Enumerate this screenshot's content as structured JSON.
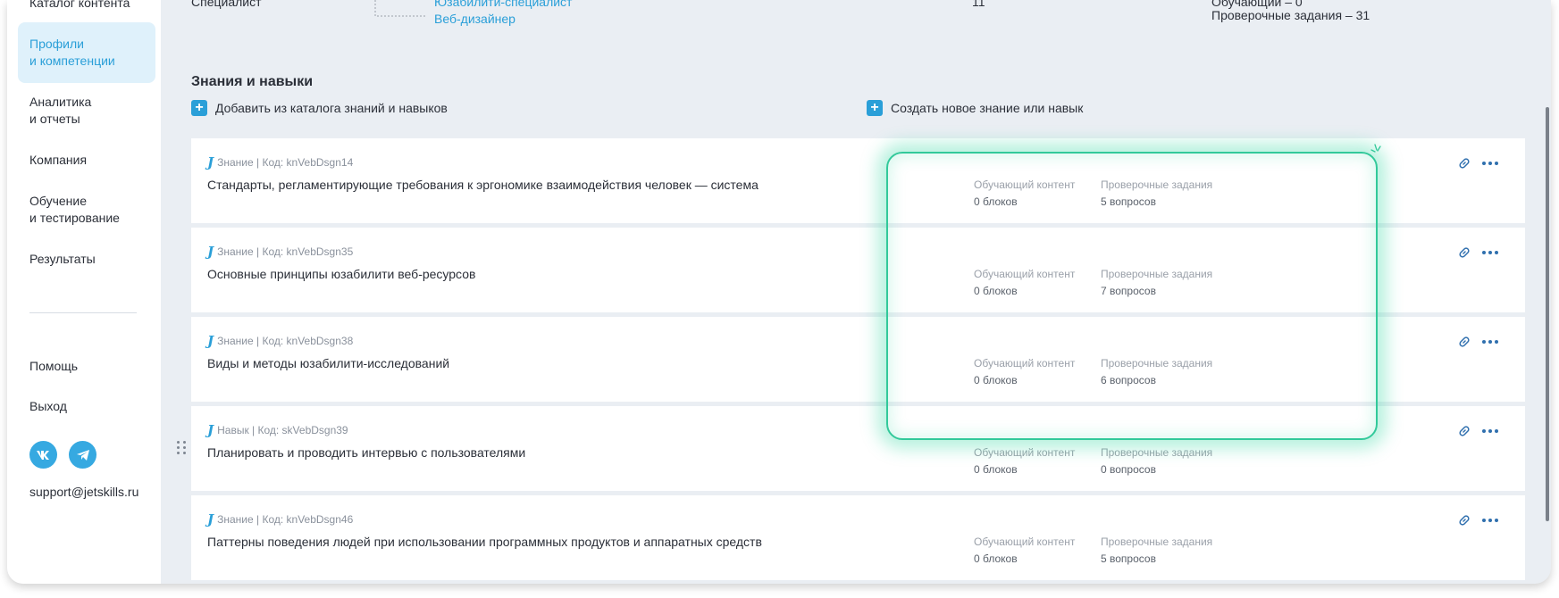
{
  "sidebar": {
    "items": [
      {
        "label": "Каталог контента"
      },
      {
        "label_line1": "Профили",
        "label_line2": "и компетенции"
      },
      {
        "label_line1": "Аналитика",
        "label_line2": "и отчеты"
      },
      {
        "label": "Компания"
      },
      {
        "label_line1": "Обучение",
        "label_line2": "и тестирование"
      },
      {
        "label": "Результаты"
      }
    ],
    "help": "Помощь",
    "logout": "Выход",
    "social": {
      "vk": "vk",
      "telegram": "telegram"
    },
    "support_email": "support@jetskills.ru"
  },
  "header_partial": {
    "left_text": "Специалист",
    "tree_item_top": "Юзабилити-специалист",
    "tree_item": "Веб-дизайнер",
    "count": "11",
    "stats_top": "Обучающий – 0",
    "stats_bottom": "Проверочные задания – 31"
  },
  "section": {
    "title": "Знания и навыки",
    "add_from_catalog": "Добавить из каталога знаний и навыков",
    "create_new": "Создать новое знание или навык",
    "col_content_label": "Обучающий контент",
    "col_tasks_label": "Проверочные задания"
  },
  "items": [
    {
      "meta": "Знание | Код: knVebDsgn14",
      "title": "Стандарты, регламентирующие требования к эргономике взаимодействия человек — система",
      "content": "0 блоков",
      "tasks": "5 вопросов"
    },
    {
      "meta": "Знание | Код: knVebDsgn35",
      "title": "Основные принципы юзабилити веб-ресурсов",
      "content": "0 блоков",
      "tasks": "7 вопросов"
    },
    {
      "meta": "Знание | Код: knVebDsgn38",
      "title": "Виды и методы юзабилити-исследований",
      "content": "0 блоков",
      "tasks": "6 вопросов"
    },
    {
      "meta": "Навык | Код: skVebDsgn39",
      "title": "Планировать и проводить интервью с пользователями",
      "content": "0 блоков",
      "tasks": "0 вопросов"
    },
    {
      "meta": "Знание | Код: knVebDsgn46",
      "title": "Паттерны поведения людей при использовании программных продуктов и аппаратных средств",
      "content": "0 блоков",
      "tasks": "5 вопросов"
    }
  ],
  "colors": {
    "accent": "#2a9fd8",
    "highlight": "#32c99a",
    "background": "#eaeef3"
  }
}
